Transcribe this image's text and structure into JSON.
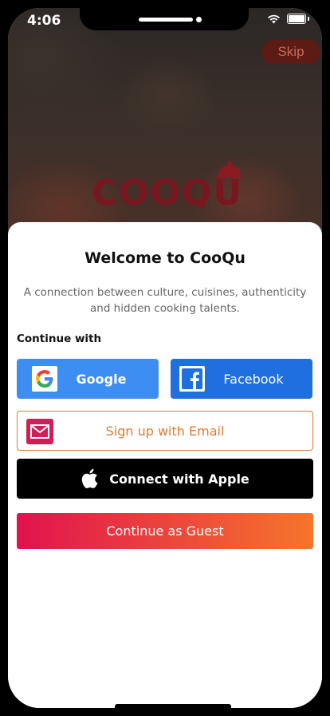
{
  "status_bar": {
    "time": "4:06"
  },
  "header": {
    "skip_label": "Skip",
    "logo_text": "COOQU"
  },
  "welcome": {
    "title": "Welcome to CooQu",
    "subtitle": "A connection between culture, cuisines, authenticity and hidden cooking talents.",
    "continue_with": "Continue with"
  },
  "buttons": {
    "google": "Google",
    "facebook": "Facebook",
    "email": "Sign up with Email",
    "apple": "Connect with Apple",
    "guest": "Continue as Guest"
  },
  "colors": {
    "google_bg": "#3d8ef3",
    "facebook_bg": "#1f6fe0",
    "email_accent": "#e6792e",
    "email_icon_bg": "#d21d57",
    "apple_bg": "#000000",
    "guest_gradient_start": "#e0134e",
    "guest_gradient_end": "#f6752b",
    "logo_color": "#7a1620"
  },
  "icons": {
    "google": "google-g-icon",
    "facebook": "facebook-f-icon",
    "email": "envelope-icon",
    "apple": "apple-icon",
    "wifi": "wifi-icon",
    "battery": "battery-icon",
    "cloche": "cloche-icon"
  }
}
